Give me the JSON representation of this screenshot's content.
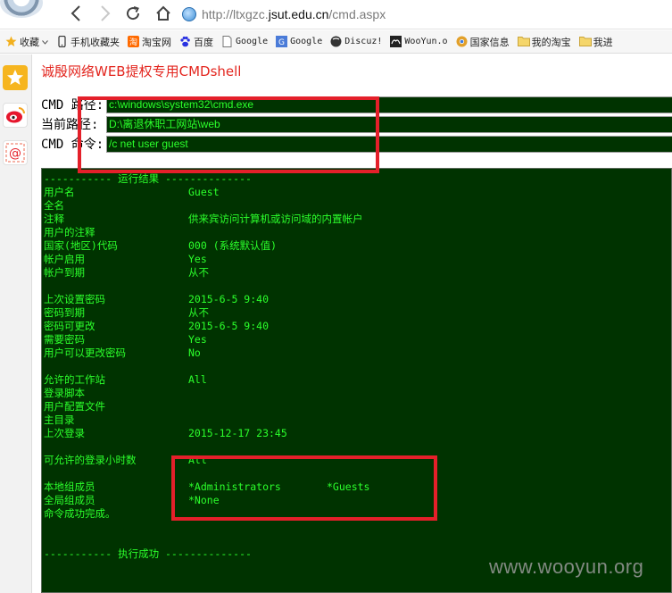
{
  "browser": {
    "url": {
      "prefix": "http://ltxgzc.",
      "domain": "jsut.edu.cn",
      "path": "/cmd.aspx"
    },
    "bookmarks": [
      {
        "label": "收藏",
        "icon": "star-icon",
        "has_arrow": true
      },
      {
        "label": "手机收藏夹",
        "icon": "phone-icon"
      },
      {
        "label": "淘宝网",
        "icon": "taobao-icon"
      },
      {
        "label": "百度",
        "icon": "baidu-paw-icon"
      },
      {
        "label": "Google",
        "icon": "page-icon",
        "mono": true
      },
      {
        "label": "Google",
        "icon": "google-icon",
        "mono": true
      },
      {
        "label": "Discuz!",
        "icon": "discuz-icon",
        "mono": true
      },
      {
        "label": "WooYun.o",
        "icon": "wooyun-icon",
        "mono": true
      },
      {
        "label": "国家信息",
        "icon": "chrome-icon"
      },
      {
        "label": "我的淘宝",
        "icon": "folder-icon"
      },
      {
        "label": "我进",
        "icon": "folder-icon"
      }
    ]
  },
  "page": {
    "title": "诚殷网络WEB提权专用CMDshell",
    "cmd_path_label": "CMD 路径:",
    "cmd_path_value": "c:\\windows\\system32\\cmd.exe",
    "current_path_label": "当前路径:",
    "current_path_value": "D:\\离退休职工网站\\web",
    "cmd_command_label": "CMD 命令:",
    "cmd_command_value": "/c net user guest"
  },
  "results": {
    "header": "----------- 运行结果 --------------",
    "footer": "----------- 执行成功 --------------",
    "rows": [
      {
        "key": "用户名",
        "value": "Guest"
      },
      {
        "key": "全名",
        "value": ""
      },
      {
        "key": "注释",
        "value": "供来宾访问计算机或访问域的内置帐户"
      },
      {
        "key": "用户的注释",
        "value": ""
      },
      {
        "key": "国家(地区)代码",
        "value": "000 (系统默认值)"
      },
      {
        "key": "帐户启用",
        "value": "Yes"
      },
      {
        "key": "帐户到期",
        "value": "从不"
      },
      {
        "key": "",
        "value": ""
      },
      {
        "key": "上次设置密码",
        "value": "2015-6-5 9:40"
      },
      {
        "key": "密码到期",
        "value": "从不"
      },
      {
        "key": "密码可更改",
        "value": "2015-6-5 9:40"
      },
      {
        "key": "需要密码",
        "value": "Yes"
      },
      {
        "key": "用户可以更改密码",
        "value": "No"
      },
      {
        "key": "",
        "value": ""
      },
      {
        "key": "允许的工作站",
        "value": "All"
      },
      {
        "key": "登录脚本",
        "value": ""
      },
      {
        "key": "用户配置文件",
        "value": ""
      },
      {
        "key": "主目录",
        "value": ""
      },
      {
        "key": "上次登录",
        "value": "2015-12-17 23:45"
      },
      {
        "key": "",
        "value": ""
      },
      {
        "key": "可允许的登录小时数",
        "value": "All"
      },
      {
        "key": "",
        "value": ""
      }
    ],
    "local_groups_label": "本地组成员",
    "local_groups": [
      "*Administrators",
      "*Guests"
    ],
    "global_groups_label": "全局组成员",
    "global_groups": [
      "*None"
    ],
    "completion": "命令成功完成。"
  },
  "watermark": "www.wooyun.org",
  "colors": {
    "terminal_bg": "#003300",
    "terminal_text": "#2bff2b",
    "title_red": "#e3261f",
    "highlight_red": "#e4202a"
  }
}
